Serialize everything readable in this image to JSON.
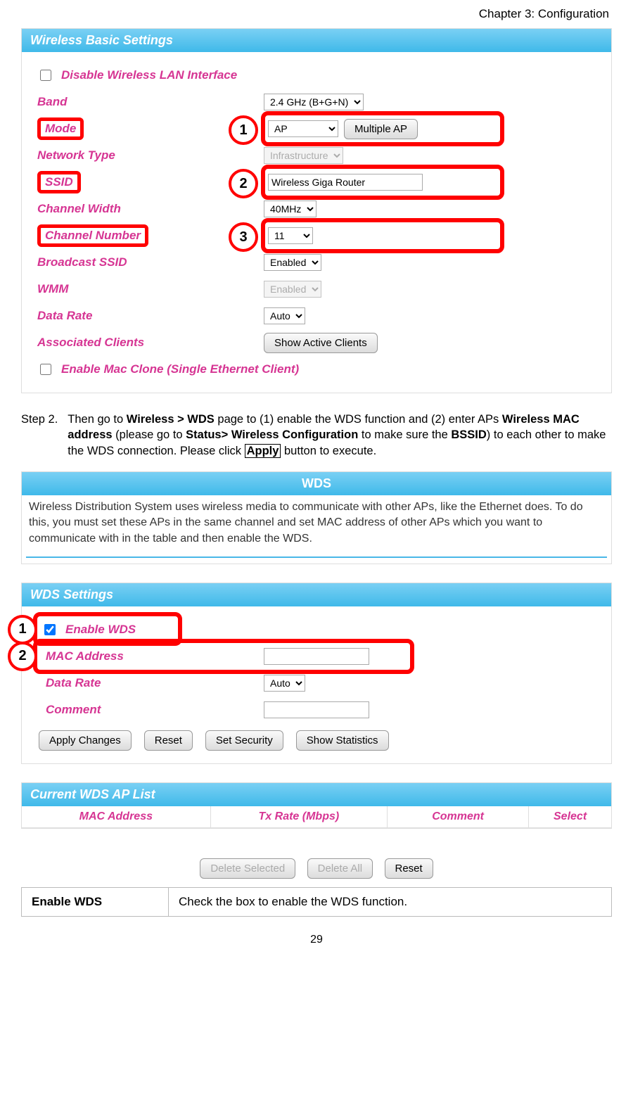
{
  "chapter_header": "Chapter 3: Configuration",
  "wireless_panel": {
    "title": "Wireless Basic Settings",
    "disable_label": "Disable Wireless LAN Interface",
    "rows": {
      "band_label": "Band",
      "band_value": "2.4 GHz (B+G+N)",
      "mode_label": "Mode",
      "mode_value": "AP",
      "multiple_ap_btn": "Multiple AP",
      "network_type_label": "Network Type",
      "network_type_value": "Infrastructure",
      "ssid_label": "SSID",
      "ssid_value": "Wireless Giga Router",
      "channel_width_label": "Channel Width",
      "channel_width_value": "40MHz",
      "channel_number_label": "Channel Number",
      "channel_number_value": "11",
      "broadcast_ssid_label": "Broadcast SSID",
      "broadcast_ssid_value": "Enabled",
      "wmm_label": "WMM",
      "wmm_value": "Enabled",
      "data_rate_label": "Data Rate",
      "data_rate_value": "Auto",
      "assoc_clients_label": "Associated Clients",
      "show_active_btn": "Show Active Clients",
      "mac_clone_label": "Enable Mac Clone (Single Ethernet Client)"
    },
    "callouts": {
      "c1": "1",
      "c2": "2",
      "c3": "3"
    }
  },
  "step2": {
    "label": "Step 2.",
    "t1": "Then go to ",
    "b1": "Wireless > WDS",
    "t2": " page to (1) enable the WDS function and (2) enter APs ",
    "b2": "Wireless MAC address",
    "t3": " (please go to ",
    "b3": "Status> Wireless  Configuration",
    "t4": " to make sure the ",
    "b4": "BSSID",
    "t5": ") to each other to make the WDS connection. Please click ",
    "apply": "Apply",
    "t6": " button to execute."
  },
  "wds_header": {
    "title": "WDS",
    "description": "Wireless Distribution System uses wireless media to communicate with other APs, like the Ethernet does. To do this, you must set these APs in the same channel and set MAC address of other APs which you want to communicate with in the table and then enable the WDS."
  },
  "wds_settings": {
    "title": "WDS Settings",
    "enable_label": "Enable WDS",
    "mac_label": "MAC Address",
    "mac_value": "",
    "data_rate_label": "Data Rate",
    "data_rate_value": "Auto",
    "comment_label": "Comment",
    "comment_value": "",
    "buttons": {
      "apply": "Apply Changes",
      "reset": "Reset",
      "set_security": "Set Security",
      "show_stats": "Show Statistics"
    },
    "callouts": {
      "c1": "1",
      "c2": "2"
    }
  },
  "current_list": {
    "title": "Current WDS AP List",
    "headers": {
      "mac": "MAC Address",
      "tx": "Tx Rate (Mbps)",
      "comment": "Comment",
      "select": "Select"
    },
    "buttons": {
      "del_sel": "Delete Selected",
      "del_all": "Delete All",
      "reset": "Reset"
    }
  },
  "explain": {
    "key": "Enable WDS",
    "val": "Check the box to enable the WDS function."
  },
  "page_number": "29"
}
